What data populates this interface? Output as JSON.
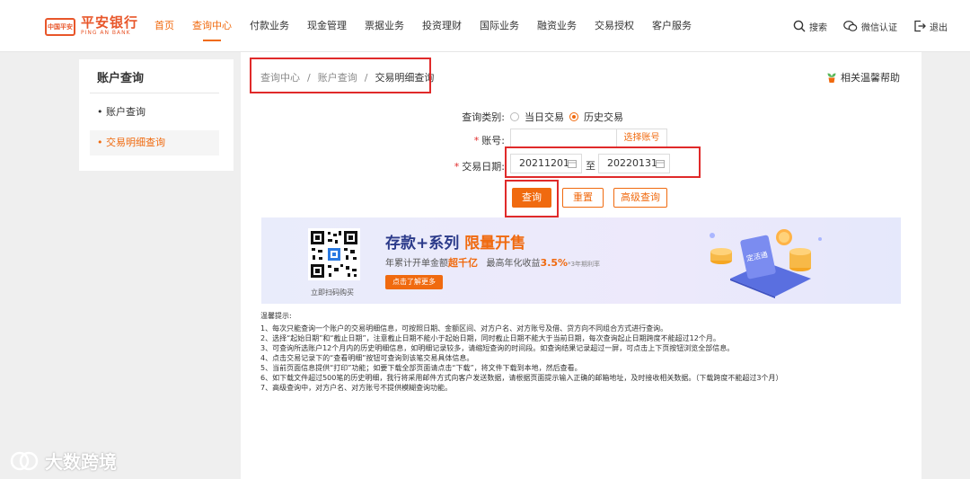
{
  "colors": {
    "accent": "#f06a0f",
    "highlight": "#e02a2a",
    "brand": "#e8562a"
  },
  "header": {
    "logo": {
      "box_text": "中国平安",
      "name_cn": "平安银行",
      "name_en": "PING AN BANK"
    },
    "nav": [
      {
        "label": "首页"
      },
      {
        "label": "查询中心",
        "active": true
      },
      {
        "label": "付款业务"
      },
      {
        "label": "现金管理"
      },
      {
        "label": "票据业务"
      },
      {
        "label": "投资理财"
      },
      {
        "label": "国际业务"
      },
      {
        "label": "融资业务"
      },
      {
        "label": "交易授权"
      },
      {
        "label": "客户服务"
      }
    ],
    "tools": {
      "search": "搜索",
      "wechat": "微信认证",
      "logout": "退出"
    }
  },
  "sidebar": {
    "title": "账户查询",
    "items": [
      {
        "label": "账户查询",
        "bullet": "•"
      },
      {
        "label": "交易明细查询",
        "bullet": "•",
        "active": true
      }
    ]
  },
  "breadcrumb": {
    "items": [
      "查询中心",
      "账户查询",
      "交易明细查询"
    ],
    "separator": "/"
  },
  "help": {
    "label": "相关温馨帮助"
  },
  "form": {
    "query_type": {
      "label": "查询类别:",
      "options": [
        "当日交易",
        "历史交易"
      ],
      "selected": "历史交易"
    },
    "account": {
      "label": "账号:",
      "value": "",
      "link": "选择账号"
    },
    "date": {
      "label": "交易日期:",
      "start": "20211201",
      "to": "至",
      "end": "20220131"
    },
    "required_mark": "*",
    "buttons": {
      "query": "查询",
      "reset": "重置",
      "advanced": "高级查询"
    }
  },
  "banner": {
    "title_main": "存款+系列",
    "title_hot": "限量开售",
    "sub_prefix": "年累计开单金额",
    "sub_amount": "超千亿",
    "sub_rate_prefix": "最高年化收益",
    "sub_rate": "3.5%",
    "sub_note": "*3年期利率",
    "button": "点击了解更多",
    "qr_caption": "立即扫码购买",
    "card_text": "定活通"
  },
  "tips": {
    "title": "温馨提示:",
    "lines": [
      "1、每次只能查询一个账户的交易明细信息，可按照日期、金额区间、对方户名、对方账号及借、贷方向不同组合方式进行查询。",
      "2、选择“起始日期”和“截止日期”，注意截止日期不能小于起始日期，同时截止日期不能大于当前日期，每次查询起止日期跨度不能超过12个月。",
      "3、可查询所选账户12个月内的历史明细信息，如明细记录较多，请缩短查询的时间段。如查询结果记录超过一屏，可点击上下页按钮浏览全部信息。",
      "4、点击交易记录下的“查看明细”按钮可查询到该笔交易具体信息。",
      "5、当前页面信息提供“打印”功能；如要下载全部页面请点击“下载”，将文件下载到本地，然后查看。",
      "6、如下载文件超过500笔的历史明细，我行将采用邮件方式向客户发送数据，请根据页面提示输入正确的邮箱地址，及时接收相关数据。（下载跨度不能超过3个月）",
      "7、高级查询中，对方户名、对方账号不提供模糊查询功能。"
    ]
  },
  "watermark": {
    "text": "大数跨境"
  }
}
